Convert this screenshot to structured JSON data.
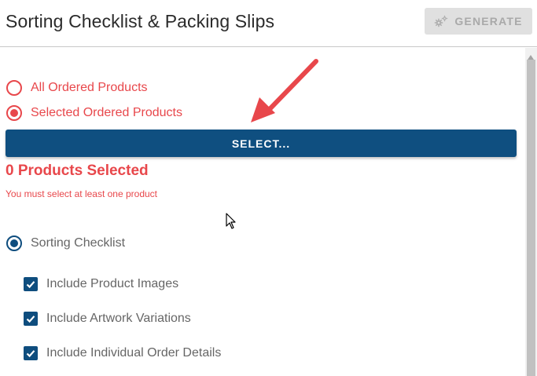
{
  "header": {
    "title": "Sorting Checklist & Packing Slips",
    "generate_label": "GENERATE"
  },
  "product_scope": {
    "options": [
      {
        "label": "All Ordered Products",
        "selected": false
      },
      {
        "label": "Selected Ordered Products",
        "selected": true
      }
    ],
    "select_button_label": "SELECT...",
    "selected_count_text": "0 Products Selected",
    "error_text": "You must select at least one product"
  },
  "sorting_checklist": {
    "label": "Sorting Checklist",
    "selected": true,
    "options": [
      {
        "label": "Include Product Images",
        "checked": true
      },
      {
        "label": "Include Artwork Variations",
        "checked": true
      },
      {
        "label": "Include Individual Order Details",
        "checked": true
      }
    ]
  },
  "colors": {
    "accent_red": "#e8474b",
    "primary_blue": "#0f4f80",
    "disabled_grey": "#e0e0e0"
  },
  "icons": {
    "generate_icon": "gears-icon",
    "annotation": "red-arrow-icon",
    "pointer": "mouse-cursor-icon"
  }
}
